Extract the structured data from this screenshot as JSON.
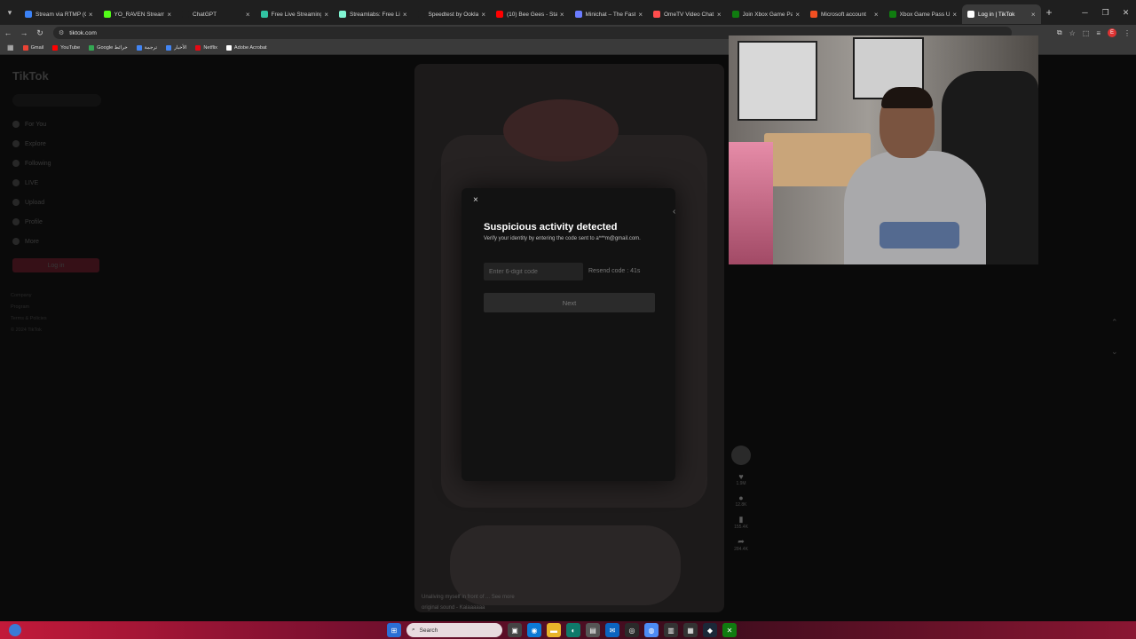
{
  "browser": {
    "tabs": [
      {
        "label": "Stream via RTMP (C",
        "color": "#3b82f6",
        "active": false
      },
      {
        "label": "YO_RAVEN Stream",
        "color": "#53fc18",
        "active": false
      },
      {
        "label": "ChatGPT",
        "color": "#1f1f1f",
        "active": false
      },
      {
        "label": "Free Live Streaming",
        "color": "#31c3a2",
        "active": false
      },
      {
        "label": "Streamlabs: Free Li",
        "color": "#80f5d2",
        "active": false
      },
      {
        "label": "Speedtest by Ookla",
        "color": "#1f1f1f",
        "active": false
      },
      {
        "label": "(10) Bee Gees - Stay",
        "color": "#ff0000",
        "active": false
      },
      {
        "label": "Minichat – The Fast",
        "color": "#6b7cff",
        "active": false
      },
      {
        "label": "OmeTV Video Chat",
        "color": "#ff4d4d",
        "active": false
      },
      {
        "label": "Join Xbox Game Pa",
        "color": "#107c10",
        "active": false
      },
      {
        "label": "Microsoft account",
        "color": "#f25022",
        "active": false
      },
      {
        "label": "Xbox Game Pass Ul",
        "color": "#107c10",
        "active": false
      },
      {
        "label": "Log in | TikTok",
        "color": "#ffffff",
        "active": true
      }
    ],
    "url": "tiktok.com",
    "bookmarks": [
      {
        "label": "Gmail",
        "color": "#ea4335"
      },
      {
        "label": "YouTube",
        "color": "#ff0000"
      },
      {
        "label": "Google خرائط",
        "color": "#34a853"
      },
      {
        "label": "ترجمة",
        "color": "#4285f4"
      },
      {
        "label": "الأخبار",
        "color": "#4285f4"
      },
      {
        "label": "Netflix",
        "color": "#e50914"
      },
      {
        "label": "Adobe Acrobat",
        "color": "#ffffff"
      }
    ]
  },
  "sidebar": {
    "logo": "TikTok",
    "items": [
      "For You",
      "Explore",
      "Following",
      "LIVE",
      "Upload",
      "Profile",
      "More"
    ],
    "login_label": "Log in",
    "footer": [
      "Company",
      "Program",
      "Terms & Policies",
      "© 2024 TikTok"
    ]
  },
  "video": {
    "caption": "Unaliving myself in front of ... See more",
    "sound": "original sound - Kaiaaaaaa"
  },
  "actions": {
    "likes": "1.9M",
    "comments": "12.8K",
    "saves": "155.4K",
    "shares": "284.4K"
  },
  "modal": {
    "close_icon": "×",
    "back_icon": "‹",
    "title": "Suspicious activity detected",
    "subtitle": "Verify your identity by entering the code sent to a***m@gmail.com.",
    "code_placeholder": "Enter 6-digit code",
    "resend_label": "Resend code : 41s",
    "next_label": "Next"
  },
  "taskbar": {
    "search_placeholder": "Search"
  },
  "colors": {
    "accent": "#fe2c55",
    "modal_bg": "#121212"
  }
}
